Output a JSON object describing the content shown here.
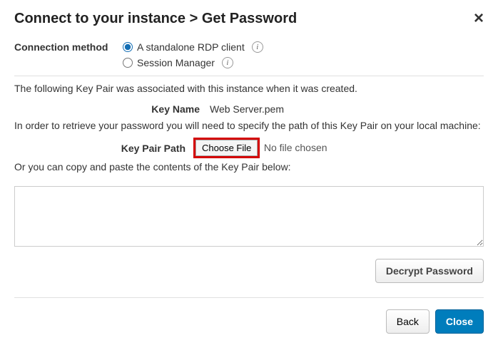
{
  "title": "Connect to your instance > Get Password",
  "connection_method_label": "Connection method",
  "radio_rdp": "A standalone RDP client",
  "radio_session": "Session Manager",
  "desc_associated": "The following Key Pair was associated with this instance when it was created.",
  "key_name_label": "Key Name",
  "key_name_value": "Web Server.pem",
  "desc_retrieve": "In order to retrieve your password you will need to specify the path of this Key Pair on your local machine:",
  "key_pair_path_label": "Key Pair Path",
  "choose_file": "Choose File",
  "no_file": "No file chosen",
  "desc_copy": "Or you can copy and paste the contents of the Key Pair below:",
  "decrypt_btn": "Decrypt Password",
  "back_btn": "Back",
  "close_btn": "Close"
}
